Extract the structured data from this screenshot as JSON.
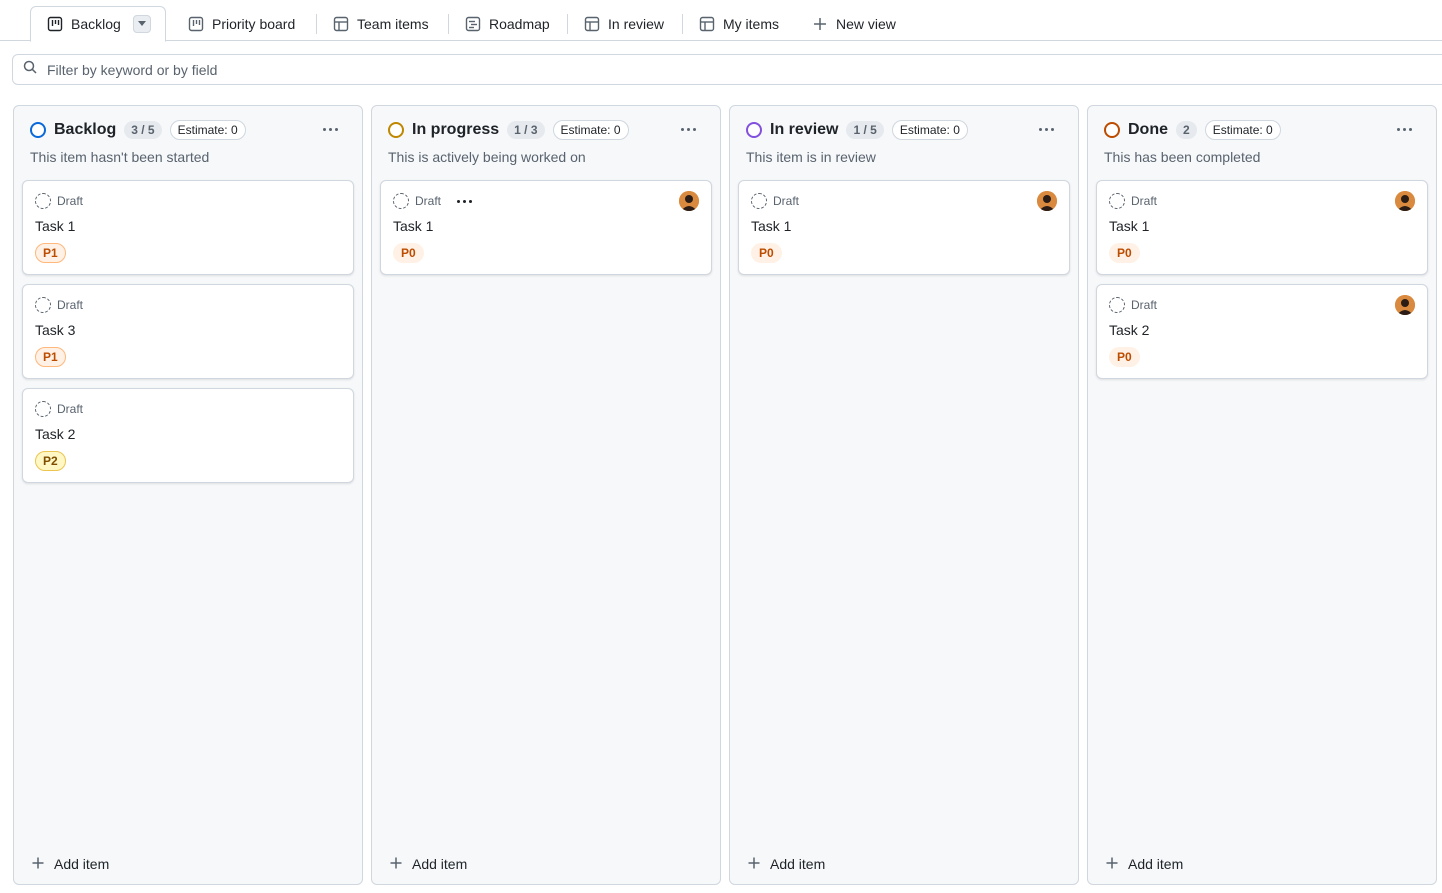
{
  "tabs": [
    {
      "label": "Backlog",
      "icon": "board-icon",
      "active": true
    },
    {
      "label": "Priority board",
      "icon": "board-icon"
    },
    {
      "label": "Team items",
      "icon": "table-icon"
    },
    {
      "label": "Roadmap",
      "icon": "roadmap-icon"
    },
    {
      "label": "In review",
      "icon": "table-icon"
    },
    {
      "label": "My items",
      "icon": "table-icon"
    },
    {
      "label": "New view",
      "icon": "plus-icon"
    }
  ],
  "filter": {
    "placeholder": "Filter by keyword or by field"
  },
  "colors": {
    "backlog": "#0969da",
    "in_progress": "#bf8700",
    "in_review": "#8250df",
    "done": "#bc4c00",
    "p0_bg": "#fff1e5",
    "p0_fg": "#bc4c00",
    "p1_bg": "#fff1e5",
    "p1_fg": "#bc4c00",
    "p1_border": "#ffb77c",
    "p2_bg": "#fff8c5",
    "p2_fg": "#7d4e00",
    "p2_border": "#eac54f"
  },
  "columns": [
    {
      "title": "Backlog",
      "count": "3 / 5",
      "estimate": "Estimate: 0",
      "description": "This item hasn't been started",
      "add_label": "Add item",
      "cards": [
        {
          "status": "Draft",
          "title": "Task 1",
          "priority": "P1"
        },
        {
          "status": "Draft",
          "title": "Task 3",
          "priority": "P1"
        },
        {
          "status": "Draft",
          "title": "Task 2",
          "priority": "P2"
        }
      ]
    },
    {
      "title": "In progress",
      "count": "1 / 3",
      "estimate": "Estimate: 0",
      "description": "This is actively being worked on",
      "add_label": "Add item",
      "cards": [
        {
          "status": "Draft",
          "title": "Task 1",
          "priority": "P0"
        }
      ]
    },
    {
      "title": "In review",
      "count": "1 / 5",
      "estimate": "Estimate: 0",
      "description": "This item is in review",
      "add_label": "Add item",
      "cards": [
        {
          "status": "Draft",
          "title": "Task 1",
          "priority": "P0"
        }
      ]
    },
    {
      "title": "Done",
      "count": "2",
      "estimate": "Estimate: 0",
      "description": "This has been completed",
      "add_label": "Add item",
      "cards": [
        {
          "status": "Draft",
          "title": "Task 1",
          "priority": "P0"
        },
        {
          "status": "Draft",
          "title": "Task 2",
          "priority": "P0"
        }
      ]
    }
  ]
}
